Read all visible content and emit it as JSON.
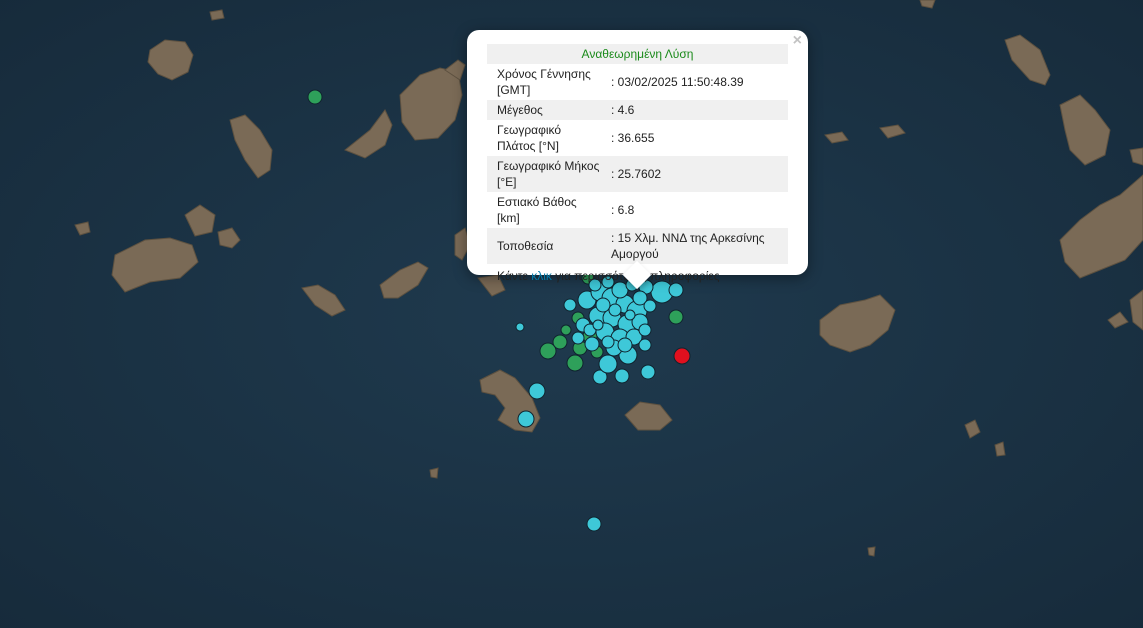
{
  "popup": {
    "title": "Αναθεωρημένη Λύση",
    "close_symbol": "×",
    "rows": [
      {
        "label": "Χρόνος Γέννησης [GMT]",
        "value": ": 03/02/2025 11:50:48.39"
      },
      {
        "label": "Μέγεθος",
        "value": ": 4.6"
      },
      {
        "label": "Γεωγραφικό Πλάτος [°N]",
        "value": ": 36.655"
      },
      {
        "label": "Γεωγραφικό Μήκος [°E]",
        "value": ": 25.7602"
      },
      {
        "label": "Εστιακό Βάθος [km]",
        "value": ": 6.8"
      },
      {
        "label": "Τοποθεσία",
        "value": ": 15 Χλμ. ΝΝΔ της Αρκεσίνης Αμοργού"
      }
    ],
    "footer_before": "Κάντε ",
    "footer_link": "κλικ",
    "footer_after": " για περισσότερες πληροφορίες"
  },
  "colors": {
    "sea": "#1d3446",
    "land": "#7a6a56",
    "quake_cyan": "#3ec8d8",
    "quake_green": "#2ea05a",
    "quake_red": "#e0101e",
    "title_green": "#1a8a1a",
    "link_blue": "#0078a8"
  },
  "icons": {
    "close": "close-icon"
  }
}
